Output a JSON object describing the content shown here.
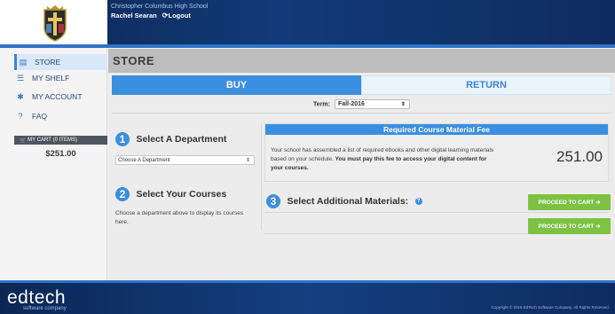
{
  "header": {
    "school_name": "Christopher Columbus High School",
    "user_name": "Rachel Searan",
    "logout_label": "Logout"
  },
  "sidebar": {
    "items": [
      {
        "label": "STORE",
        "icon": "store-icon"
      },
      {
        "label": "MY SHELF",
        "icon": "shelf-icon"
      },
      {
        "label": "MY ACCOUNT",
        "icon": "gear-icon"
      },
      {
        "label": "FAQ",
        "icon": "help-icon"
      }
    ],
    "cart": {
      "label": "MY CART",
      "items_label": "(0 ITEMS)",
      "total": "$251.00"
    }
  },
  "store": {
    "title": "STORE",
    "tabs": {
      "buy": "BUY",
      "return": "RETURN"
    },
    "term_label": "Term:",
    "term_value": "Fall-2016",
    "step1": {
      "number": "1",
      "title": "Select A Department",
      "select_placeholder": "Choose A Department"
    },
    "step2": {
      "number": "2",
      "title": "Select Your Courses",
      "text": "Choose a department above to display its courses here."
    },
    "step3": {
      "number": "3",
      "title": "Select Additional Materials:"
    },
    "fee": {
      "header": "Required Course Material Fee",
      "text": "Your school has assembled a list of required ebooks and other digital learning materials based on your schedule.",
      "text_bold": "You must pay this fee to access your digital content for your courses.",
      "amount": "251.00"
    },
    "proceed_label": "PROCEED TO CART ➔"
  },
  "footer": {
    "brand": "edtech",
    "brand_sub": "software company",
    "copyright": "Copyright © 2016 EdTech Software Company. All Rights Reserved."
  },
  "colors": {
    "header": "#0b2755",
    "accent": "#3b8fe0",
    "proceed": "#7cc243"
  }
}
